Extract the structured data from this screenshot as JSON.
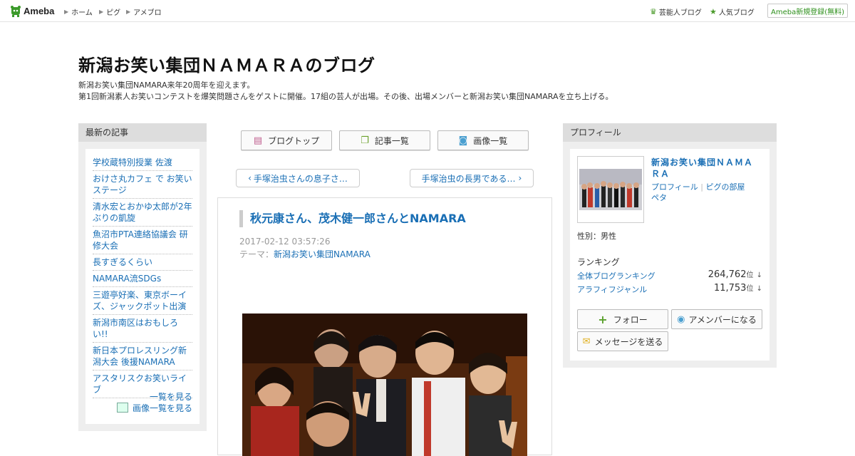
{
  "header": {
    "logo": "Ameba",
    "nav": [
      "ホーム",
      "ピグ",
      "アメブロ"
    ],
    "right_links": [
      "芸能人ブログ",
      "人気ブログ"
    ],
    "signup": "Ameba新規登録(無料)"
  },
  "blog": {
    "title": "新潟お笑い集団ＮＡＭＡＲＡのブログ",
    "desc1": "新潟お笑い集団NAMARA来年20周年を迎えます。",
    "desc2": "第1回新潟素人お笑いコンテストを爆笑問題さんをゲストに開催。17組の芸人が出場。その後、出場メンバーと新潟お笑い集団NAMARAを立ち上げる。"
  },
  "left": {
    "heading": "最新の記事",
    "items": [
      "学校蔵特別授業 佐渡",
      "おけさ丸カフェ で お笑いステージ",
      "清水宏とおかゆ太郎が2年ぶりの凱旋",
      "魚沼市PTA連絡協議会 研修大会",
      "長すぎるくらい",
      "NAMARA流SDGs",
      "三遊亭好楽、東京ボーイズ、ジャックポット出演",
      "新潟市南区はおもしろい!!",
      "新日本プロレスリング新潟大会 後援NAMARA",
      "アスタリスクお笑いライブ"
    ],
    "see_list": "一覧を見る",
    "see_images": "画像一覧を見る"
  },
  "center": {
    "buttons": {
      "top": "ブログトップ",
      "list": "記事一覧",
      "images": "画像一覧"
    },
    "prev": "手塚治虫さんの息子さ…",
    "next": "手塚治虫の長男である…",
    "article": {
      "title": "秋元康さん、茂木健一郎さんとNAMARA",
      "date": "2017-02-12 03:57:26",
      "theme_label": "テーマ：",
      "theme": "新潟お笑い集団NAMARA"
    }
  },
  "right": {
    "heading": "プロフィール",
    "name": "新潟お笑い集団ＮＡＭＡＲＡ",
    "link_profile": "プロフィール",
    "link_pig": "ピグの部屋",
    "link_peta": "ペタ",
    "gender": "性別：男性",
    "ranking_heading": "ランキング",
    "ranks": [
      {
        "label": "全体ブログランキング",
        "value": "264,762",
        "unit": "位"
      },
      {
        "label": "アラフィフジャンル",
        "value": "11,753",
        "unit": "位"
      }
    ],
    "follow": "フォロー",
    "amember": "アメンバーになる",
    "message": "メッセージを送る"
  },
  "colors": {
    "link": "#1a6fb5",
    "green": "#2d8f1b"
  }
}
